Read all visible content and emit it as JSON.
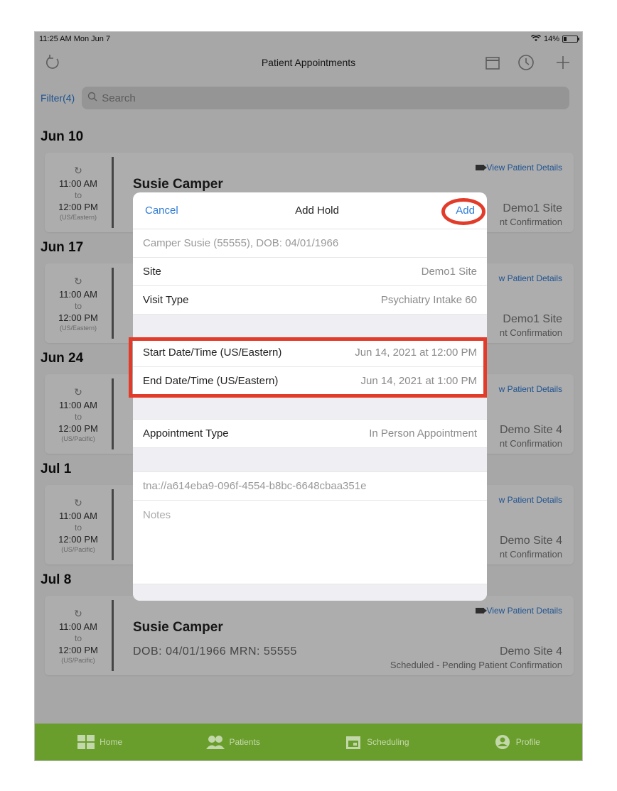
{
  "status_bar": {
    "time": "11:25 AM  Mon Jun 7",
    "battery": "14%"
  },
  "header": {
    "title": "Patient Appointments",
    "icons": [
      "refresh-icon",
      "calendar-icon",
      "clock-icon",
      "plus-icon"
    ]
  },
  "filter": {
    "label": "Filter(4)",
    "search_placeholder": "Search"
  },
  "groups": [
    {
      "date": "Jun 10",
      "start": "11:00 AM",
      "to": "to",
      "end": "12:00 PM",
      "tz": "(US/Eastern)",
      "name": "Susie Camper",
      "site": "Demo1 Site",
      "status": "nt Confirmation",
      "vpd": "View Patient Details"
    },
    {
      "date": "Jun 17",
      "start": "11:00 AM",
      "to": "to",
      "end": "12:00 PM",
      "tz": "(US/Eastern)",
      "site": "Demo1 Site",
      "status": "nt Confirmation",
      "vpd": "w Patient Details"
    },
    {
      "date": "Jun 24",
      "start": "11:00 AM",
      "to": "to",
      "end": "12:00 PM",
      "tz": "(US/Pacific)",
      "site": "Demo Site 4",
      "status": "nt Confirmation",
      "vpd": "w Patient Details"
    },
    {
      "date": "Jul 1",
      "start": "11:00 AM",
      "to": "to",
      "end": "12:00 PM",
      "tz": "(US/Pacific)",
      "site": "Demo Site 4",
      "status": "nt Confirmation",
      "vpd": "w Patient Details"
    },
    {
      "date": "Jul 8",
      "start": "11:00 AM",
      "to": "to",
      "end": "12:00 PM",
      "tz": "(US/Pacific)",
      "name": "Susie Camper",
      "dob": "DOB: 04/01/1966   MRN: 55555",
      "site": "Demo Site 4",
      "status": "Scheduled - Pending Patient Confirmation",
      "vpd": "View Patient Details"
    }
  ],
  "modal": {
    "cancel": "Cancel",
    "title": "Add Hold",
    "add": "Add",
    "patient": "Camper Susie (55555), DOB: 04/01/1966",
    "site_label": "Site",
    "site_value": "Demo1 Site",
    "visit_label": "Visit Type",
    "visit_value": "Psychiatry Intake 60",
    "start_label": "Start Date/Time (US/Eastern)",
    "start_value": "Jun 14, 2021 at 12:00 PM",
    "end_label": "End Date/Time (US/Eastern)",
    "end_value": "Jun 14, 2021 at 1:00 PM",
    "appt_type_label": "Appointment Type",
    "appt_type_value": "In Person Appointment",
    "link": "tna://a614eba9-096f-4554-b8bc-6648cbaa351e",
    "notes_placeholder": "Notes"
  },
  "tabs": [
    "Home",
    "Patients",
    "Scheduling",
    "Profile"
  ],
  "colors": {
    "accent": "#2f7bd6",
    "tabbar": "#6a9e2c",
    "highlight": "#e23b2a"
  }
}
